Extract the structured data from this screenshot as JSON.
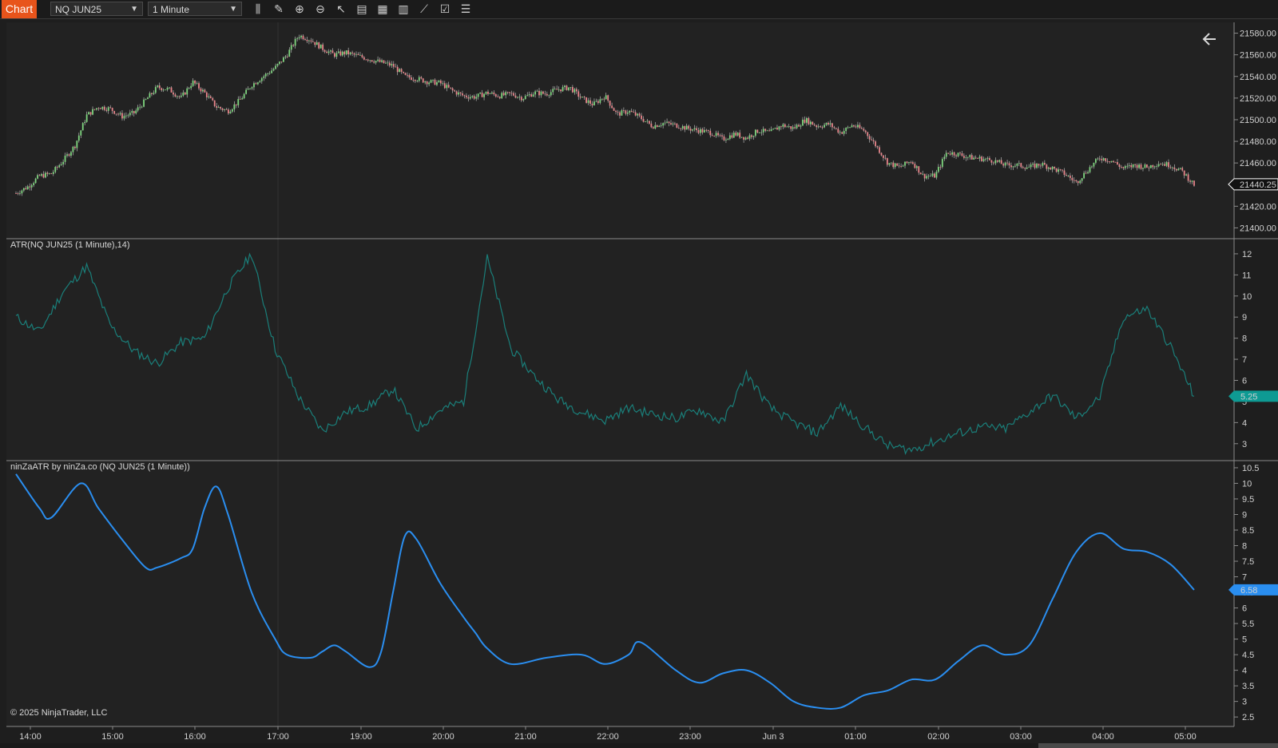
{
  "toolbar": {
    "chart_tab_label": "Chart",
    "instrument": "NQ JUN25",
    "interval": "1 Minute",
    "tools": [
      {
        "name": "bar-type-icon",
        "glyph": "⫼"
      },
      {
        "name": "drawing-pencil-icon",
        "glyph": "✎"
      },
      {
        "name": "zoom-in-icon",
        "glyph": "⊕"
      },
      {
        "name": "zoom-out-icon",
        "glyph": "⊖"
      },
      {
        "name": "pointer-icon",
        "glyph": "↖"
      },
      {
        "name": "data-box-icon",
        "glyph": "▤"
      },
      {
        "name": "strategy-icon",
        "glyph": "▦"
      },
      {
        "name": "chart-trader-icon",
        "glyph": "▥"
      },
      {
        "name": "indicators-icon",
        "glyph": "⟋"
      },
      {
        "name": "properties-icon",
        "glyph": "☑"
      },
      {
        "name": "templates-icon",
        "glyph": "☰"
      }
    ]
  },
  "colors": {
    "background": "#222222",
    "up_candle": "#7fd67f",
    "down_candle": "#e8848a",
    "atr_line": "#1a7f7a",
    "ninza_line": "#2a8ef0",
    "price_marker": "#ffffff",
    "atr_marker": "#0e9a93",
    "ninza_marker": "#2a8ef0"
  },
  "copyright": "© 2025 NinjaTrader, LLC",
  "back_arrow_icon": "arrow-left-icon",
  "x_axis": {
    "labels": [
      "14:00",
      "15:00",
      "16:00",
      "17:00",
      "19:00",
      "20:00",
      "21:00",
      "22:00",
      "23:00",
      "Jun 3",
      "01:00",
      "02:00",
      "03:00",
      "04:00",
      "05:00"
    ]
  },
  "chart_data": [
    {
      "type": "candlestick",
      "title": "NQ JUN25 (1 Minute)",
      "ylim": [
        21390,
        21590
      ],
      "ticks": [
        "21580.00",
        "21560.00",
        "21540.00",
        "21520.00",
        "21500.00",
        "21480.00",
        "21460.00",
        "21440.00",
        "21420.00",
        "21400.00"
      ],
      "last_value": "21440.25",
      "path_points": [
        [
          0,
          21432
        ],
        [
          0.01,
          21438
        ],
        [
          0.02,
          21448
        ],
        [
          0.03,
          21450
        ],
        [
          0.04,
          21462
        ],
        [
          0.05,
          21476
        ],
        [
          0.06,
          21504
        ],
        [
          0.07,
          21512
        ],
        [
          0.08,
          21510
        ],
        [
          0.09,
          21503
        ],
        [
          0.1,
          21506
        ],
        [
          0.11,
          21518
        ],
        [
          0.12,
          21530
        ],
        [
          0.13,
          21528
        ],
        [
          0.14,
          21520
        ],
        [
          0.15,
          21535
        ],
        [
          0.16,
          21525
        ],
        [
          0.17,
          21512
        ],
        [
          0.18,
          21508
        ],
        [
          0.19,
          21518
        ],
        [
          0.2,
          21532
        ],
        [
          0.21,
          21540
        ],
        [
          0.22,
          21548
        ],
        [
          0.23,
          21560
        ],
        [
          0.24,
          21578
        ],
        [
          0.25,
          21574
        ],
        [
          0.26,
          21566
        ],
        [
          0.27,
          21560
        ],
        [
          0.28,
          21562
        ],
        [
          0.29,
          21559
        ],
        [
          0.3,
          21556
        ],
        [
          0.31,
          21553
        ],
        [
          0.32,
          21550
        ],
        [
          0.33,
          21540
        ],
        [
          0.34,
          21538
        ],
        [
          0.35,
          21535
        ],
        [
          0.36,
          21534
        ],
        [
          0.37,
          21527
        ],
        [
          0.38,
          21522
        ],
        [
          0.39,
          21521
        ],
        [
          0.4,
          21525
        ],
        [
          0.41,
          21522
        ],
        [
          0.42,
          21524
        ],
        [
          0.43,
          21520
        ],
        [
          0.44,
          21525
        ],
        [
          0.45,
          21524
        ],
        [
          0.46,
          21528
        ],
        [
          0.47,
          21530
        ],
        [
          0.48,
          21520
        ],
        [
          0.49,
          21514
        ],
        [
          0.5,
          21522
        ],
        [
          0.51,
          21505
        ],
        [
          0.52,
          21508
        ],
        [
          0.53,
          21502
        ],
        [
          0.54,
          21494
        ],
        [
          0.55,
          21497
        ],
        [
          0.56,
          21495
        ],
        [
          0.57,
          21492
        ],
        [
          0.58,
          21490
        ],
        [
          0.59,
          21488
        ],
        [
          0.6,
          21482
        ],
        [
          0.61,
          21487
        ],
        [
          0.62,
          21483
        ],
        [
          0.63,
          21490
        ],
        [
          0.64,
          21488
        ],
        [
          0.65,
          21495
        ],
        [
          0.66,
          21492
        ],
        [
          0.67,
          21500
        ],
        [
          0.68,
          21494
        ],
        [
          0.69,
          21496
        ],
        [
          0.7,
          21488
        ],
        [
          0.71,
          21495
        ],
        [
          0.72,
          21490
        ],
        [
          0.73,
          21476
        ],
        [
          0.74,
          21460
        ],
        [
          0.75,
          21456
        ],
        [
          0.76,
          21462
        ],
        [
          0.77,
          21448
        ],
        [
          0.78,
          21448
        ],
        [
          0.79,
          21470
        ],
        [
          0.8,
          21468
        ],
        [
          0.81,
          21465
        ],
        [
          0.82,
          21464
        ],
        [
          0.83,
          21462
        ],
        [
          0.84,
          21458
        ],
        [
          0.85,
          21458
        ],
        [
          0.86,
          21456
        ],
        [
          0.87,
          21459
        ],
        [
          0.88,
          21455
        ],
        [
          0.89,
          21450
        ],
        [
          0.9,
          21442
        ],
        [
          0.91,
          21454
        ],
        [
          0.92,
          21465
        ],
        [
          0.93,
          21462
        ],
        [
          0.94,
          21455
        ],
        [
          0.95,
          21458
        ],
        [
          0.96,
          21456
        ],
        [
          0.97,
          21460
        ],
        [
          0.98,
          21458
        ],
        [
          0.99,
          21452
        ],
        [
          1.0,
          21440
        ]
      ]
    },
    {
      "type": "line",
      "title": "ATR(NQ JUN25 (1 Minute),14)",
      "ylim": [
        2.5,
        12.3
      ],
      "ticks": [
        12,
        11,
        10,
        9,
        8,
        7,
        6,
        5,
        4,
        3
      ],
      "last_value": "5.25",
      "x": [
        0,
        0.02,
        0.04,
        0.06,
        0.08,
        0.1,
        0.12,
        0.14,
        0.16,
        0.18,
        0.2,
        0.22,
        0.24,
        0.26,
        0.28,
        0.3,
        0.32,
        0.34,
        0.36,
        0.38,
        0.4,
        0.42,
        0.44,
        0.46,
        0.48,
        0.5,
        0.52,
        0.54,
        0.56,
        0.58,
        0.6,
        0.62,
        0.64,
        0.66,
        0.68,
        0.7,
        0.72,
        0.74,
        0.76,
        0.78,
        0.8,
        0.82,
        0.84,
        0.86,
        0.88,
        0.9,
        0.92,
        0.94,
        0.96,
        0.98,
        1.0
      ],
      "values": [
        9.0,
        8.3,
        10.2,
        11.4,
        8.6,
        7.4,
        6.8,
        7.8,
        8.0,
        10.4,
        12.0,
        7.5,
        5.2,
        3.6,
        4.5,
        4.8,
        5.6,
        3.7,
        4.6,
        5.0,
        11.8,
        7.5,
        6.2,
        5.1,
        4.5,
        4.1,
        4.7,
        4.4,
        4.2,
        4.6,
        4.0,
        6.3,
        4.7,
        4.0,
        3.5,
        4.8,
        3.8,
        2.9,
        2.7,
        3.1,
        3.5,
        3.8,
        3.7,
        4.5,
        5.3,
        4.2,
        5.2,
        9.0,
        9.4,
        7.6,
        5.25
      ]
    },
    {
      "type": "line",
      "title": "ninZaATR by ninZa.co (NQ JUN25 (1 Minute))",
      "ylim": [
        2.35,
        10.55
      ],
      "ticks": [
        10.5,
        10,
        9.5,
        9,
        8.5,
        8,
        7.5,
        7,
        6.5,
        6,
        5.5,
        5,
        4.5,
        4,
        3.5,
        3,
        2.5
      ],
      "last_value": "6.58",
      "x": [
        0,
        0.02,
        0.03,
        0.055,
        0.07,
        0.09,
        0.11,
        0.12,
        0.14,
        0.15,
        0.16,
        0.17,
        0.18,
        0.2,
        0.22,
        0.23,
        0.25,
        0.26,
        0.27,
        0.28,
        0.3,
        0.31,
        0.32,
        0.33,
        0.34,
        0.36,
        0.38,
        0.39,
        0.4,
        0.42,
        0.45,
        0.48,
        0.5,
        0.52,
        0.53,
        0.56,
        0.58,
        0.6,
        0.62,
        0.64,
        0.66,
        0.68,
        0.7,
        0.72,
        0.74,
        0.76,
        0.78,
        0.8,
        0.82,
        0.84,
        0.86,
        0.88,
        0.9,
        0.92,
        0.94,
        0.96,
        0.98,
        1.0
      ],
      "values": [
        10.3,
        9.2,
        8.9,
        10.0,
        9.2,
        8.2,
        7.3,
        7.3,
        7.6,
        7.9,
        9.2,
        9.9,
        9.0,
        6.5,
        5.0,
        4.5,
        4.4,
        4.6,
        4.8,
        4.6,
        4.1,
        4.6,
        6.5,
        8.3,
        8.2,
        6.8,
        5.7,
        5.2,
        4.7,
        4.2,
        4.4,
        4.5,
        4.2,
        4.5,
        4.9,
        4.0,
        3.6,
        3.9,
        4.0,
        3.6,
        3.0,
        2.8,
        2.8,
        3.2,
        3.35,
        3.7,
        3.7,
        4.3,
        4.8,
        4.5,
        4.8,
        6.3,
        7.8,
        8.4,
        7.9,
        7.8,
        7.4,
        6.58
      ]
    }
  ]
}
